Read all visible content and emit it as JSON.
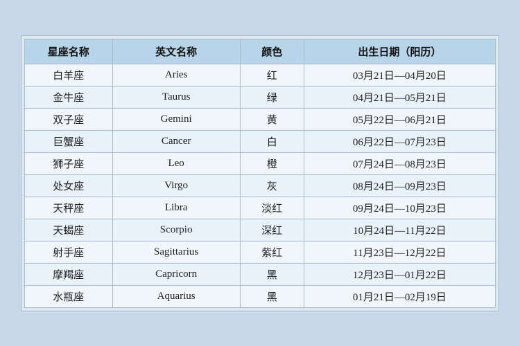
{
  "headers": {
    "col1": "星座名称",
    "col2": "英文名称",
    "col3": "颜色",
    "col4": "出生日期（阳历）"
  },
  "rows": [
    {
      "chinese": "白羊座",
      "english": "Aries",
      "color": "红",
      "date": "03月21日—04月20日"
    },
    {
      "chinese": "金牛座",
      "english": "Taurus",
      "color": "绿",
      "date": "04月21日—05月21日"
    },
    {
      "chinese": "双子座",
      "english": "Gemini",
      "color": "黄",
      "date": "05月22日—06月21日"
    },
    {
      "chinese": "巨蟹座",
      "english": "Cancer",
      "color": "白",
      "date": "06月22日—07月23日"
    },
    {
      "chinese": "狮子座",
      "english": "Leo",
      "color": "橙",
      "date": "07月24日—08月23日"
    },
    {
      "chinese": "处女座",
      "english": "Virgo",
      "color": "灰",
      "date": "08月24日—09月23日"
    },
    {
      "chinese": "天秤座",
      "english": "Libra",
      "color": "淡红",
      "date": "09月24日—10月23日"
    },
    {
      "chinese": "天蝎座",
      "english": "Scorpio",
      "color": "深红",
      "date": "10月24日—11月22日"
    },
    {
      "chinese": "射手座",
      "english": "Sagittarius",
      "color": "紫红",
      "date": "11月23日—12月22日"
    },
    {
      "chinese": "摩羯座",
      "english": "Capricorn",
      "color": "黑",
      "date": "12月23日—01月22日"
    },
    {
      "chinese": "水瓶座",
      "english": "Aquarius",
      "color": "黑",
      "date": "01月21日—02月19日"
    }
  ]
}
